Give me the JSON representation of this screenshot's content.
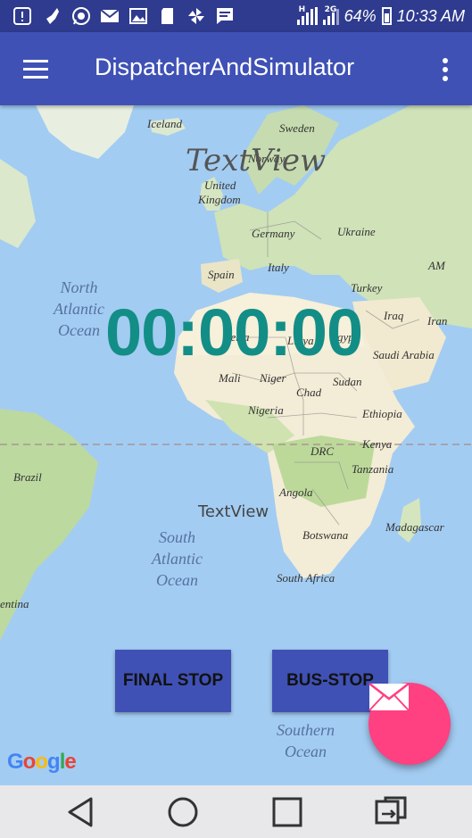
{
  "status_bar": {
    "battery": "64%",
    "time": "10:33 AM",
    "net1": "H",
    "net2": "2G"
  },
  "app_bar": {
    "title": "DispatcherAndSimulator"
  },
  "map": {
    "labels": {
      "iceland": "Iceland",
      "sweden": "Sweden",
      "norway": "Norway",
      "united_kingdom_1": "United",
      "united_kingdom_2": "Kingdom",
      "germany": "Germany",
      "ukraine": "Ukraine",
      "spain": "Spain",
      "italy": "Italy",
      "turkey": "Turkey",
      "iraq": "Iraq",
      "iran": "Iran",
      "algeria": "geria",
      "libya": "Libya",
      "egypt": "gypt",
      "saudi_arabia": "Saudi Arabia",
      "mali": "Mali",
      "niger": "Niger",
      "chad": "Chad",
      "sudan": "Sudan",
      "nigeria": "Nigeria",
      "ethiopia": "Ethiopia",
      "kenya": "Kenya",
      "drc": "DRC",
      "tanzania": "Tanzania",
      "brazil": "Brazil",
      "angola": "Angola",
      "madagascar": "Madagascar",
      "botswana": "Botswana",
      "south_africa": "South Africa",
      "argentina": "entina",
      "am": "AM"
    },
    "oceans": {
      "north_atlantic": [
        "North",
        "Atlantic",
        "Ocean"
      ],
      "south_atlantic": [
        "South",
        "Atlantic",
        "Ocean"
      ],
      "southern": [
        "Southern",
        "Ocean"
      ]
    },
    "attribution": "Google"
  },
  "overlay": {
    "textview_top": "TextView",
    "timer": "00:00:00",
    "textview_mid": "TextView"
  },
  "buttons": {
    "final_stop": "FINAL STOP",
    "bus_stop": "BUS-STOP"
  },
  "colors": {
    "primary": "#3f51b5",
    "status": "#2f3b8e",
    "accent": "#ff4081",
    "timer": "#128e87",
    "water": "#a3ccf2"
  }
}
